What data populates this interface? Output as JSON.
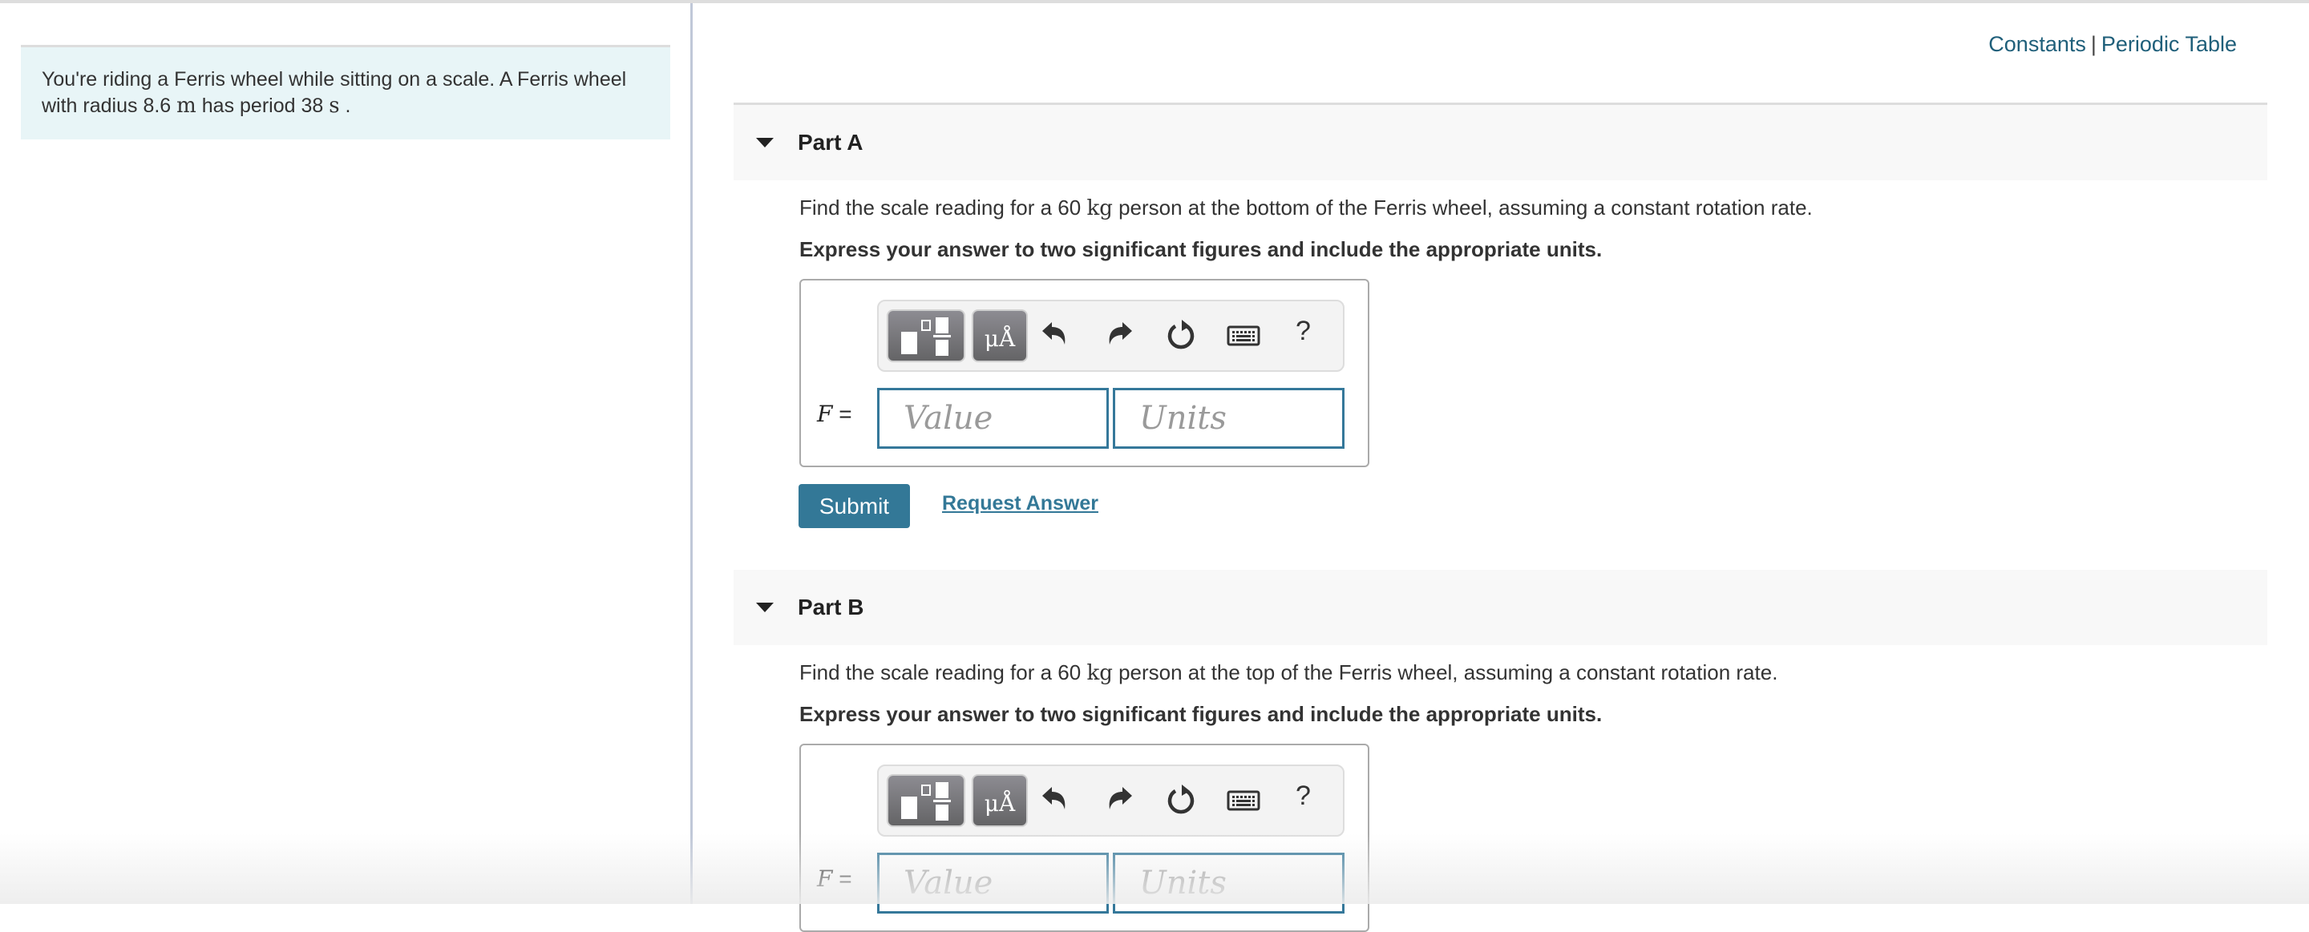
{
  "intro": {
    "text_before_radius": "You're riding a Ferris wheel while sitting on a scale. A Ferris wheel with radius ",
    "radius_value": "8.6",
    "radius_unit": "m",
    "text_mid": " has period ",
    "period_value": "38",
    "period_unit": "s",
    "text_end": " ."
  },
  "top_links": {
    "constants": "Constants",
    "separator": "|",
    "periodic_table": "Periodic Table"
  },
  "parts": [
    {
      "label": "Part A",
      "question_before": "Find the scale reading for a 60 ",
      "question_unit": "kg",
      "question_after": " person at the bottom of the Ferris wheel, assuming a constant rotation rate.",
      "instruction": "Express your answer to two significant figures and include the appropriate units.",
      "variable": "F",
      "equals": "=",
      "value_placeholder": "Value",
      "units_placeholder": "Units",
      "submit_label": "Submit",
      "request_label": "Request Answer"
    },
    {
      "label": "Part B",
      "question_before": "Find the scale reading for a 60 ",
      "question_unit": "kg",
      "question_after": " person at the top of the Ferris wheel, assuming a constant rotation rate.",
      "instruction": "Express your answer to two significant figures and include the appropriate units.",
      "variable": "F",
      "equals": "=",
      "value_placeholder": "Value",
      "units_placeholder": "Units"
    }
  ],
  "toolbar": {
    "templates_icon": "templates-icon",
    "units_label": "μÅ",
    "undo_icon": "undo-icon",
    "redo_icon": "redo-icon",
    "reset_icon": "reset-icon",
    "keyboard_icon": "keyboard-icon",
    "help_label": "?"
  },
  "colors": {
    "accent": "#337897",
    "link": "#1f5f7a",
    "intro_bg": "#e8f5f7",
    "header_bg": "#f8f8f8"
  }
}
